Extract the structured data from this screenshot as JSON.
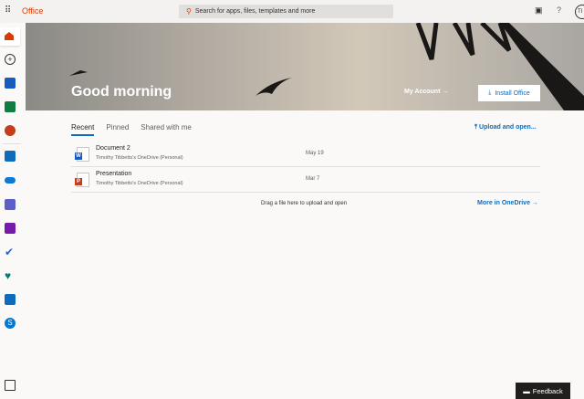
{
  "header": {
    "brand": "Office",
    "search_placeholder": "Search for apps, files, templates and more",
    "avatar": "TI"
  },
  "sidebar": {
    "items": [
      "home",
      "create",
      "word",
      "excel",
      "powerpoint",
      "outlook",
      "onedrive",
      "teams",
      "onenote",
      "todo",
      "family-safety",
      "store",
      "skype",
      "all-apps"
    ]
  },
  "banner": {
    "greeting": "Good morning",
    "my_account": "My Account →",
    "install": "Install Office"
  },
  "tabs": [
    "Recent",
    "Pinned",
    "Shared with me"
  ],
  "upload": "Upload and open...",
  "files": [
    {
      "name": "Document 2",
      "location": "Timothy Tibbetts's OneDrive (Personal)",
      "date": "May 19",
      "type": "W",
      "color": "#185abd"
    },
    {
      "name": "Presentation",
      "location": "Timothy Tibbetts's OneDrive (Personal)",
      "date": "Mar 7",
      "type": "P",
      "color": "#c43e1c"
    }
  ],
  "drag_hint": "Drag a file here to upload and open",
  "more_onedrive": "More in OneDrive →",
  "feedback": "Feedback"
}
